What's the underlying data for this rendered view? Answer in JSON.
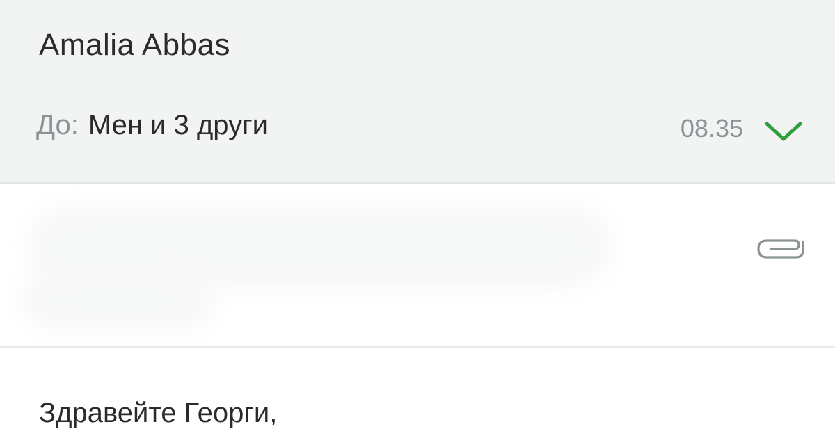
{
  "message": {
    "sender": "Amalia Abbas",
    "to_label": "До:",
    "to_value": "Мен и 3 други",
    "time": "08.35",
    "greeting": "Здравейте Георги,"
  },
  "icons": {
    "expand": "chevron-down-icon",
    "attachment": "paperclip-icon"
  },
  "colors": {
    "header_bg": "#f2f3f3",
    "accent_green": "#2e9e3e",
    "muted_text": "#8c9396",
    "primary_text": "#2b2b2b"
  }
}
